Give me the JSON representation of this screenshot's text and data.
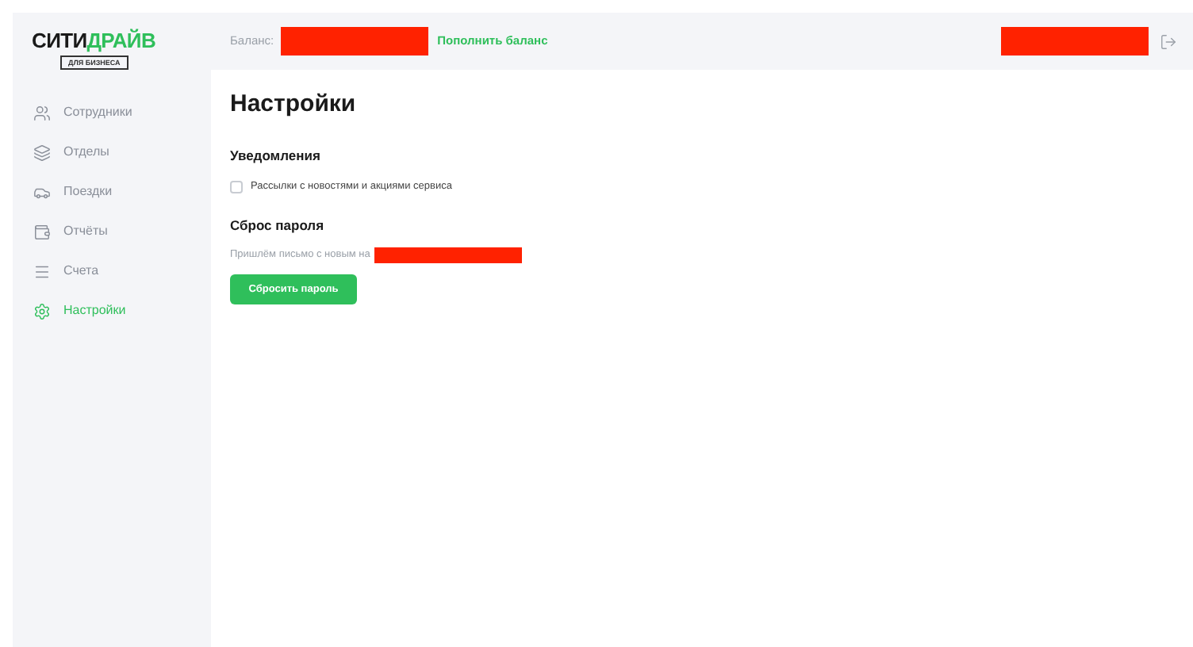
{
  "logo": {
    "part_1": "СИТИ",
    "part_2": "ДРАЙВ",
    "badge": "ДЛЯ БИЗНЕСА"
  },
  "header": {
    "balance_label": "Баланс:",
    "top_up_link": "Пополнить баланс"
  },
  "sidebar": {
    "items": [
      {
        "label": "Сотрудники",
        "kind": "users",
        "selected": false
      },
      {
        "label": "Отделы",
        "kind": "layers",
        "selected": false
      },
      {
        "label": "Поездки",
        "kind": "car",
        "selected": false
      },
      {
        "label": "Отчёты",
        "kind": "wallet",
        "selected": false
      },
      {
        "label": "Счета",
        "kind": "lines",
        "selected": false
      },
      {
        "label": "Настройки",
        "kind": "gear",
        "selected": true
      }
    ]
  },
  "page": {
    "title": "Настройки",
    "notifications": {
      "heading": "Уведомления",
      "checkbox": {
        "label": "Рассылки с новостями и акциями сервиса",
        "checked": false
      }
    },
    "password_reset": {
      "heading": "Сброс пароля",
      "hint": "Пришлём письмо с новым на",
      "button": "Сбросить пароль"
    }
  }
}
